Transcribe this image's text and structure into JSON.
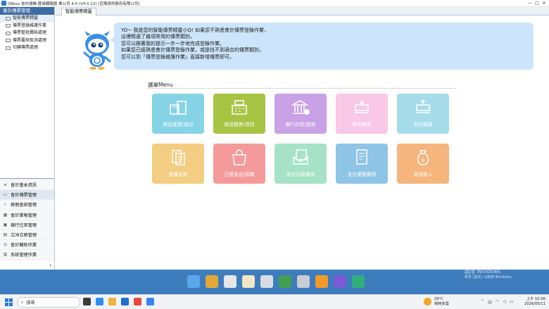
{
  "window": {
    "title": "QBoss 會計總帳-匯城網路版 單公司 4.0 (V4.0.22) [亞瑪資訊股份有限公司]",
    "controls": [
      "—",
      "□",
      "✕"
    ]
  },
  "sidebar": {
    "header": "會計傳票管理",
    "items": [
      {
        "label": "智能傳票精靈"
      },
      {
        "label": "傳票登錄維護作業"
      },
      {
        "label": "傳票整批獨核處理"
      },
      {
        "label": "傳票覆核取消處理"
      },
      {
        "label": "切轉傳票處理"
      }
    ],
    "modules": [
      {
        "label": "會計基本資訊",
        "icon": "≡"
      },
      {
        "label": "會計傳票管理",
        "icon": "▭"
      },
      {
        "label": "帳冊查詢管理",
        "icon": "⌕"
      },
      {
        "label": "會計業報管理",
        "icon": "▦"
      },
      {
        "label": "銀行往來管理",
        "icon": "▣"
      },
      {
        "label": "立沖立帳管理",
        "icon": "▤"
      },
      {
        "label": "會計輔助作業",
        "icon": "◎"
      },
      {
        "label": "系統管理作業",
        "icon": "▥"
      }
    ]
  },
  "main": {
    "tab": "智能傳票精靈",
    "bubble_lines": [
      "YO~ 我是您的智能傳票精靈小Q! 如果您不熟悉會計傳票登錄作業，",
      "這裡精選了幾項常用的傳票類別，",
      "您可以跟著我的提示一步一步地完成登錄作業。",
      "如果您已經熟悉會計傳票登錄作業，或是找不到適合的傳票類別，",
      "您可以到「傳票登錄維護作業」直接新增傳票即可。"
    ],
    "menu_title": "選單Menu",
    "tiles": [
      {
        "label": "商品進貨/退出",
        "color": "#86d3e6"
      },
      {
        "label": "商品銷售/退回",
        "color": "#a7c443"
      },
      {
        "label": "銀行存款/提款",
        "color": "#c9a1e6"
      },
      {
        "label": "收到帳款",
        "color": "#f8c8e6"
      },
      {
        "label": "支付帳款",
        "color": "#a6dcea"
      },
      {
        "label": "票據兌現",
        "color": "#f2cd82"
      },
      {
        "label": "日常支出/採購",
        "color": "#f59a9a"
      },
      {
        "label": "支付行政費用",
        "color": "#a6e2c8"
      },
      {
        "label": "支付業務費用",
        "color": "#8ec4e6"
      },
      {
        "label": "其他收入",
        "color": "#f5b57c"
      }
    ]
  },
  "dock": {
    "icons": [
      "mascot-icon",
      "scale-icon",
      "check-icon",
      "receipt-icon",
      "bank-icon",
      "bin-icon",
      "folder-icon",
      "question-icon",
      "q-icon",
      "exit-icon"
    ],
    "activate_title": "啟用 Windows",
    "activate_sub": "移至 [設定] 以啟用 Windows。"
  },
  "taskbar": {
    "search_placeholder": "搜尋",
    "weather_temp": "29°C",
    "weather_desc": "晴時多雲",
    "time": "上午 10:36",
    "date": "2026/05/11"
  }
}
